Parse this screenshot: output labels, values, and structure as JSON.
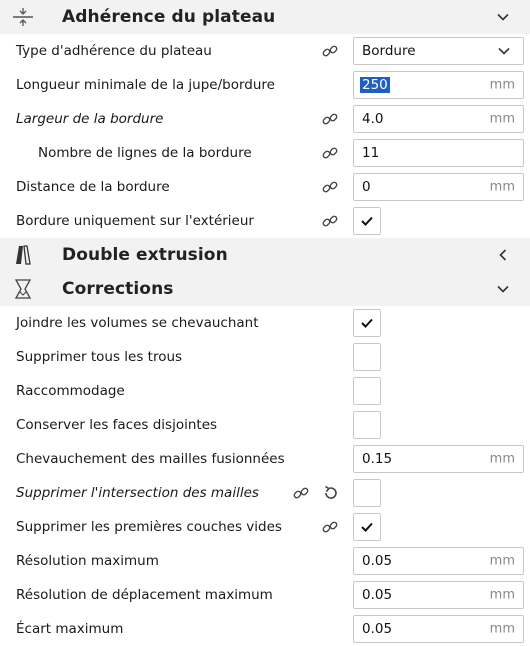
{
  "sections": {
    "adhesion": {
      "title": "Adhérence du plateau",
      "icon": "plate-adhesion-icon"
    },
    "dual": {
      "title": "Double extrusion",
      "icon": "dual-extrusion-icon"
    },
    "corrections": {
      "title": "Corrections",
      "icon": "mesh-fixes-icon"
    }
  },
  "adhesion_rows": {
    "type": {
      "label": "Type d'adhérence du plateau",
      "value": "Bordure"
    },
    "skirt_min_length": {
      "label": "Longueur minimale de la jupe/bordure",
      "value": "250",
      "unit": "mm"
    },
    "brim_width": {
      "label": "Largeur de la bordure",
      "value": "4.0",
      "unit": "mm"
    },
    "brim_line_count": {
      "label": "Nombre de lignes de la bordure",
      "value": "11"
    },
    "brim_gap": {
      "label": "Distance de la bordure",
      "value": "0",
      "unit": "mm"
    },
    "brim_outside_only": {
      "label": "Bordure uniquement sur l'extérieur",
      "checked": true
    }
  },
  "correction_rows": {
    "union_overlap": {
      "label": "Joindre les volumes se chevauchant",
      "checked": true
    },
    "remove_holes": {
      "label": "Supprimer tous les trous",
      "checked": false
    },
    "extensive_stitching": {
      "label": "Raccommodage",
      "checked": false
    },
    "keep_disconnected": {
      "label": "Conserver les faces disjointes",
      "checked": false
    },
    "merge_overlap": {
      "label": "Chevauchement des mailles fusionnées",
      "value": "0.15",
      "unit": "mm"
    },
    "remove_intersection": {
      "label": "Supprimer l'intersection des mailles",
      "checked": false
    },
    "remove_empty_first": {
      "label": "Supprimer les premières couches vides",
      "checked": true
    },
    "max_resolution": {
      "label": "Résolution maximum",
      "value": "0.05",
      "unit": "mm"
    },
    "max_travel_resolution": {
      "label": "Résolution de déplacement maximum",
      "value": "0.05",
      "unit": "mm"
    },
    "max_deviation": {
      "label": "Écart maximum",
      "value": "0.05",
      "unit": "mm"
    }
  },
  "colors": {
    "accent": "#1f5fbf",
    "section_bg": "#f2f2f2",
    "border": "#c8c8c8"
  }
}
